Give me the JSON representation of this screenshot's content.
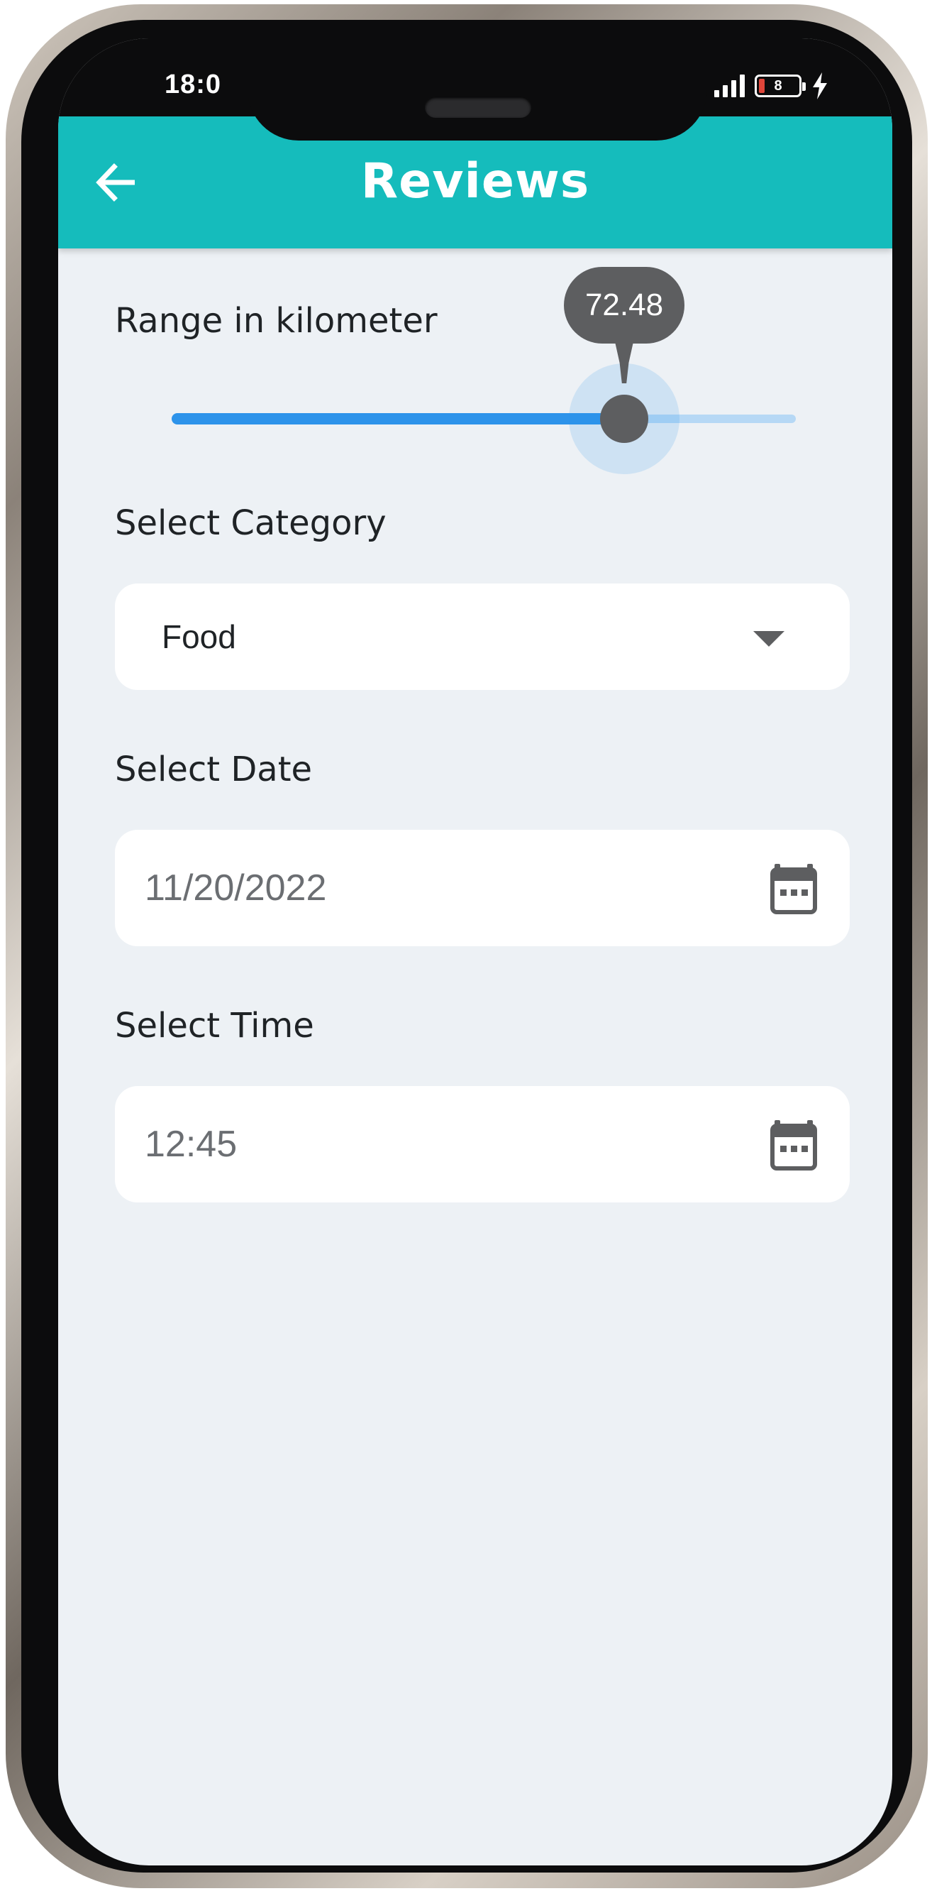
{
  "status_bar": {
    "time": "18:0",
    "battery": "8"
  },
  "app_bar": {
    "title": "Reviews",
    "back_icon": "arrow-left-icon"
  },
  "range": {
    "label": "Range in kilometer",
    "value": "72.48",
    "fraction": 0.725
  },
  "category": {
    "label": "Select Category",
    "selected": "Food",
    "icon": "dropdown-arrow-icon"
  },
  "date": {
    "label": "Select Date",
    "value": "11/20/2022",
    "icon": "calendar-icon"
  },
  "time": {
    "label": "Select Time",
    "value": "12:45",
    "icon": "calendar-icon"
  },
  "colors": {
    "app_bar": "#15bcbc",
    "slider_active": "#2d93ea",
    "slider_inactive": "#b6d8f5",
    "thumb": "#5d5e60",
    "background": "#edf1f5"
  }
}
